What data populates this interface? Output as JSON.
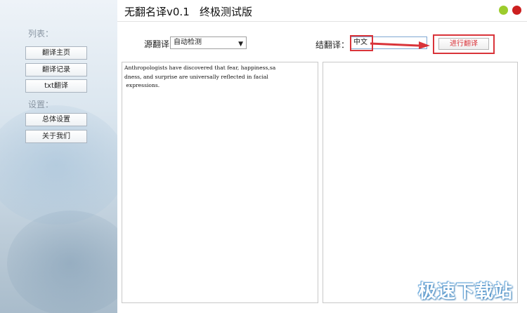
{
  "app": {
    "title": "无翻名译v0.1   终极测试版"
  },
  "sidebar": {
    "list_label": "列表：",
    "items": [
      {
        "label": "翻译主页"
      },
      {
        "label": "翻译记录"
      },
      {
        "label": "txt翻译"
      }
    ],
    "settings_label": "设置：",
    "settings_items": [
      {
        "label": "总体设置"
      },
      {
        "label": "关于我们"
      }
    ]
  },
  "controls": {
    "source_label": "源翻译：",
    "source_value": "自动检测",
    "target_label": "结翻译：",
    "target_value": "中文",
    "translate_button": "进行翻译"
  },
  "source_text": "Anthropologists have discovered that fear, happiness,sa\ndness, and surprise are universally reflected in facial\n expressions.",
  "target_text": "",
  "watermark": "极速下载站",
  "colors": {
    "highlight": "#d9343a",
    "dot_green": "#9ccc2c",
    "dot_red": "#cc1f1f"
  }
}
